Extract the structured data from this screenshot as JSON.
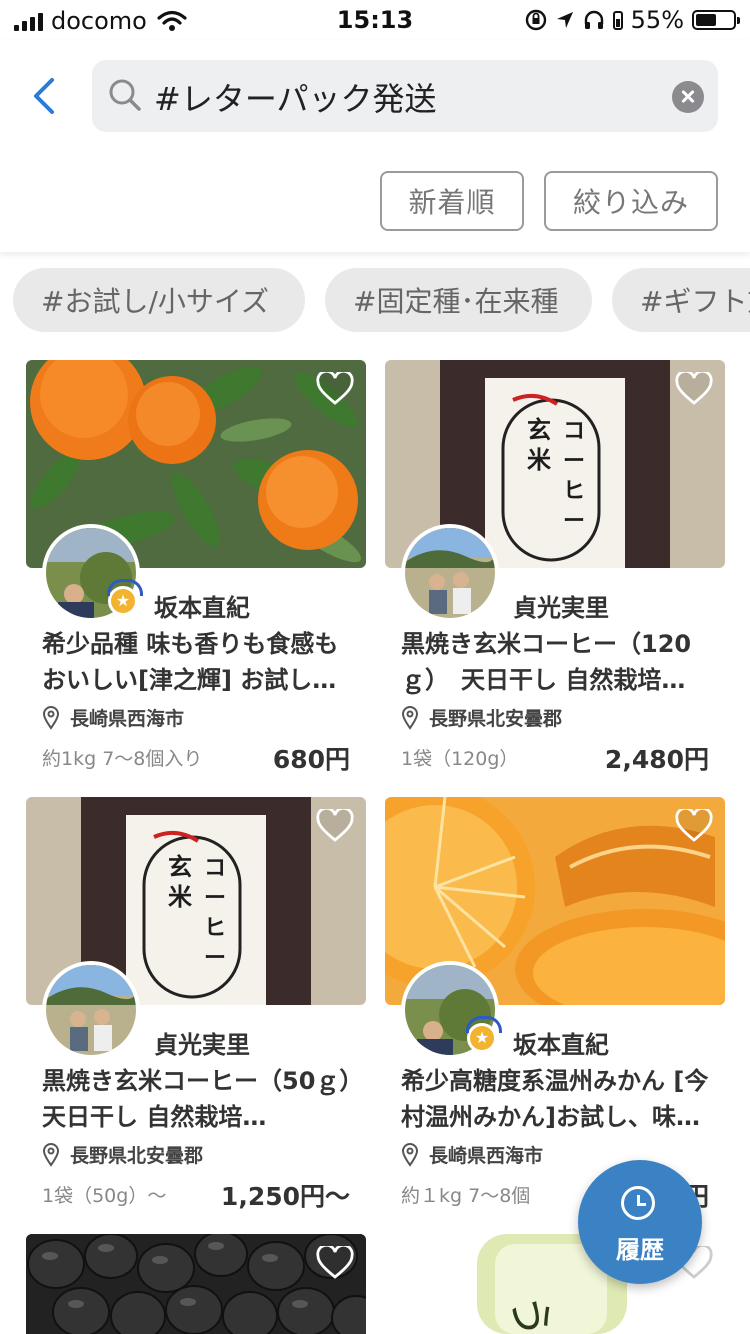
{
  "status_bar": {
    "carrier": "docomo",
    "time": "15:13",
    "battery": "55%",
    "battery_level": 0.55
  },
  "search": {
    "query": "#レターパック発送"
  },
  "filters": {
    "sort_label": "新着順",
    "filter_label": "絞り込み"
  },
  "tags": [
    "#お試し/小サイズ",
    "#固定種･在来種",
    "#ギフト対"
  ],
  "products": [
    {
      "seller": "坂本直紀",
      "title": "希少品種 味も香りも食感もおいしい[津之輝] お試し…",
      "location": "長崎県西海市",
      "quantity": "約1kg 7〜8個入り",
      "price": "680円",
      "image": "orange-tree",
      "badge": true
    },
    {
      "seller": "貞光実里",
      "title": "黒焼き玄米コーヒー（120ｇ）　天日干し 自然栽培…",
      "location": "長野県北安曇郡",
      "quantity": "1袋（120g）",
      "price": "2,480円",
      "image": "coffee-bag",
      "badge": false
    },
    {
      "seller": "貞光実里",
      "title": "黒焼き玄米コーヒー（50ｇ）　天日干し 自然栽培…",
      "location": "長野県北安曇郡",
      "quantity": "1袋（50g）〜",
      "price": "1,250円〜",
      "image": "coffee-bag",
      "badge": false
    },
    {
      "seller": "坂本直紀",
      "title": "希少高糖度系温州みかん [今村温州みかん]お試し、味…",
      "location": "長崎県西海市",
      "quantity": "約１kg 7〜8個",
      "price": "円",
      "image": "orange-slices",
      "badge": true
    }
  ],
  "fab": {
    "label": "履歴"
  },
  "colors": {
    "accent": "#3b82c4",
    "back_arrow": "#2b7bd8"
  }
}
